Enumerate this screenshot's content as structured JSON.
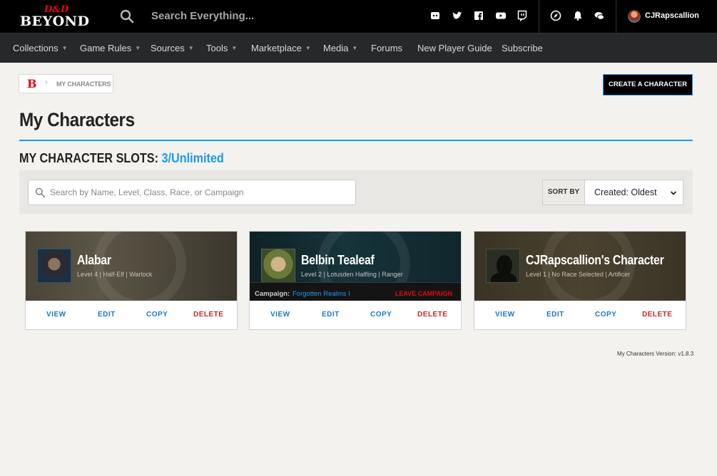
{
  "header": {
    "logo_dd": "D&D",
    "logo_beyond": "BEYOND",
    "search_placeholder": "Search Everything...",
    "username": "CJRapscallion"
  },
  "nav": {
    "items": [
      {
        "label": "Collections",
        "has_caret": true
      },
      {
        "label": "Game Rules",
        "has_caret": true
      },
      {
        "label": "Sources",
        "has_caret": true
      },
      {
        "label": "Tools",
        "has_caret": true
      },
      {
        "label": "Marketplace",
        "has_caret": true
      },
      {
        "label": "Media",
        "has_caret": true
      },
      {
        "label": "Forums",
        "has_caret": false
      },
      {
        "label": "New Player Guide",
        "has_caret": false
      },
      {
        "label": "Subscribe",
        "has_caret": false
      }
    ]
  },
  "breadcrumb": {
    "logo": "B",
    "current": "MY CHARACTERS"
  },
  "create_button": "CREATE A CHARACTER",
  "page_title": "My Characters",
  "slots": {
    "label": "MY CHARACTER SLOTS:",
    "count": "3/Unlimited"
  },
  "filter": {
    "search_placeholder": "Search by Name, Level, Class, Race, or Campaign",
    "sort_label": "SORT BY",
    "sort_value": "Created: Oldest"
  },
  "characters": [
    {
      "name": "Alabar",
      "subtitle": "Level 4 | Half-Elf | Warlock",
      "actions": [
        "VIEW",
        "EDIT",
        "COPY",
        "DELETE"
      ]
    },
    {
      "name": "Belbin Tealeaf",
      "subtitle": "Level 2 | Lotusden Halfling | Ranger",
      "campaign_label": "Campaign:",
      "campaign_name": "Forgotten Realms I",
      "leave_campaign": "LEAVE CAMPAIGN",
      "actions": [
        "VIEW",
        "EDIT",
        "COPY",
        "DELETE"
      ]
    },
    {
      "name": "CJRapscallion's Character",
      "subtitle": "Level 1 | No Race Selected | Artificer",
      "actions": [
        "VIEW",
        "EDIT",
        "COPY",
        "DELETE"
      ]
    }
  ],
  "version": "My Characters Version: v1.8.3",
  "colors": {
    "accent_blue": "#1b9af0",
    "danger_red": "#c52a2a",
    "brand_red": "#e40712",
    "topbar": "#000000",
    "navbar": "#26282a"
  }
}
